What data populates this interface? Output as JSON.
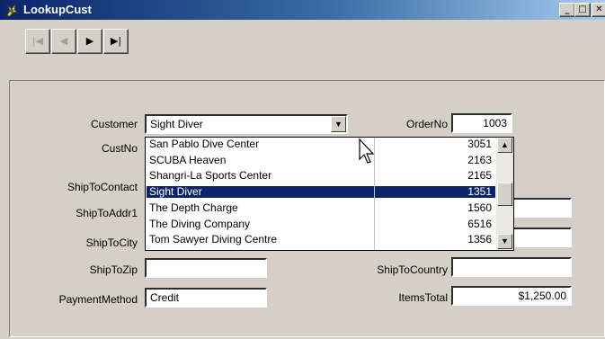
{
  "window": {
    "title": "LookupCust",
    "controls": {
      "minimize": "_",
      "maximize": "□",
      "close": "✕"
    }
  },
  "navigator": {
    "buttons": [
      {
        "name": "first",
        "glyph": "|◀",
        "enabled": false
      },
      {
        "name": "prior",
        "glyph": "◀",
        "enabled": false
      },
      {
        "name": "next",
        "glyph": "▶",
        "enabled": true
      },
      {
        "name": "last",
        "glyph": "▶|",
        "enabled": true
      }
    ]
  },
  "form": {
    "customer": {
      "label": "Customer",
      "value": "Sight Diver"
    },
    "order_no": {
      "label": "OrderNo",
      "value": "1003"
    },
    "cust_no": {
      "label": "CustNo"
    },
    "ship_to_contact": {
      "label": "ShipToContact"
    },
    "ship_to_addr1": {
      "label": "ShipToAddr1"
    },
    "ship_to_city": {
      "label": "ShipToCity"
    },
    "ship_to_zip": {
      "label": "ShipToZip",
      "value": ""
    },
    "ship_to_country": {
      "label": "ShipToCountry",
      "value": ""
    },
    "payment_method": {
      "label": "PaymentMethod",
      "value": "Credit"
    },
    "items_total": {
      "label": "ItemsTotal",
      "value": "$1,250.00"
    }
  },
  "dropdown": {
    "rows": [
      {
        "name": "San Pablo Dive Center",
        "num": "3051",
        "selected": false
      },
      {
        "name": "SCUBA Heaven",
        "num": "2163",
        "selected": false
      },
      {
        "name": "Shangri-La Sports Center",
        "num": "2165",
        "selected": false
      },
      {
        "name": "Sight Diver",
        "num": "1351",
        "selected": true
      },
      {
        "name": "The Depth Charge",
        "num": "1560",
        "selected": false
      },
      {
        "name": "The Diving Company",
        "num": "6516",
        "selected": false
      },
      {
        "name": "Tom Sawyer Diving Centre",
        "num": "1356",
        "selected": false
      }
    ]
  },
  "colors": {
    "title_gradient_start": "#0a246a",
    "title_gradient_end": "#a6caf0",
    "face": "#d4d0c8",
    "selection": "#0a246a"
  },
  "icons": [
    "app-icon",
    "arrow-cursor-icon"
  ]
}
